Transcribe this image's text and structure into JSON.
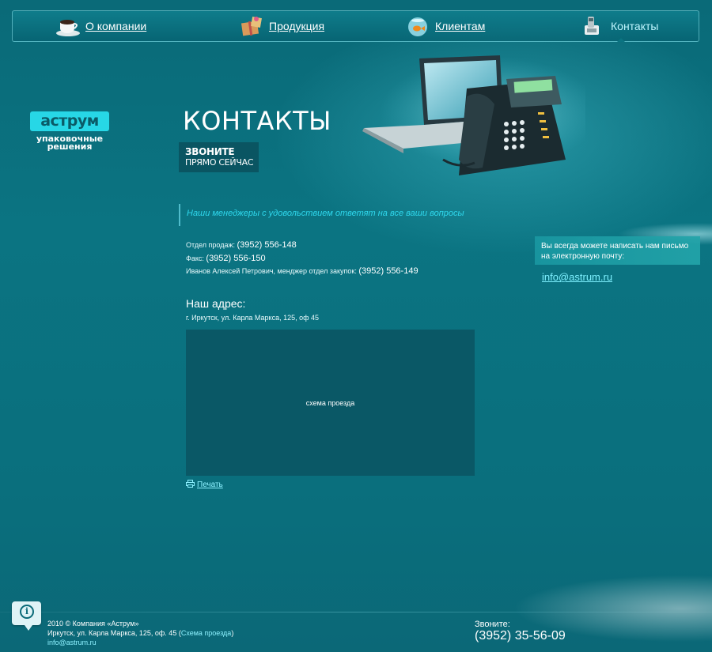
{
  "nav": {
    "items": [
      {
        "label": "О компании",
        "icon": "coffee-cup-icon"
      },
      {
        "label": "Продукция",
        "icon": "gift-box-icon"
      },
      {
        "label": "Клиентам",
        "icon": "goldfish-bowl-icon"
      },
      {
        "label": "Контакты",
        "icon": "phone-icon",
        "active": true
      }
    ]
  },
  "logo": {
    "name": "аструм",
    "sub1": "упаковочные",
    "sub2": "решения"
  },
  "page": {
    "title": "КОНТАКТЫ",
    "callnow_line1": "ЗВОНИТЕ",
    "callnow_line2": "ПРЯМО СЕЙЧАС"
  },
  "intro": "Наши менеджеры с удовольствием ответят на все ваши вопросы",
  "contacts": [
    {
      "label": "Отдел продаж:",
      "number": "(3952) 556-148"
    },
    {
      "label": "Факс:",
      "number": "(3952) 556-150"
    },
    {
      "label": "Иванов Алексей Петрович, менджер отдел закупок:",
      "number": "(3952) 556-149"
    }
  ],
  "address": {
    "heading": "Наш адрес:",
    "value": "г. Иркутск, ул. Карла Маркса, 125, оф 45"
  },
  "map": {
    "placeholder": "схема проезда"
  },
  "print": {
    "label": "Печать"
  },
  "sidebar": {
    "write_text": "Вы всегда можете написать нам письмо на электронную почту:",
    "email": "info@astrum.ru"
  },
  "footer": {
    "copyright": "2010 © Компания «Аструм»",
    "address": "Иркутск, ул. Карла Маркса, 125, оф. 45",
    "map_link": "Схема проезда",
    "email": "info@astrum.ru",
    "call_label": "Звоните:",
    "phone": "(3952) 35-56-09"
  },
  "colors": {
    "background": "#0b7482",
    "accent": "#27d7e6",
    "link": "#8df1ff"
  }
}
